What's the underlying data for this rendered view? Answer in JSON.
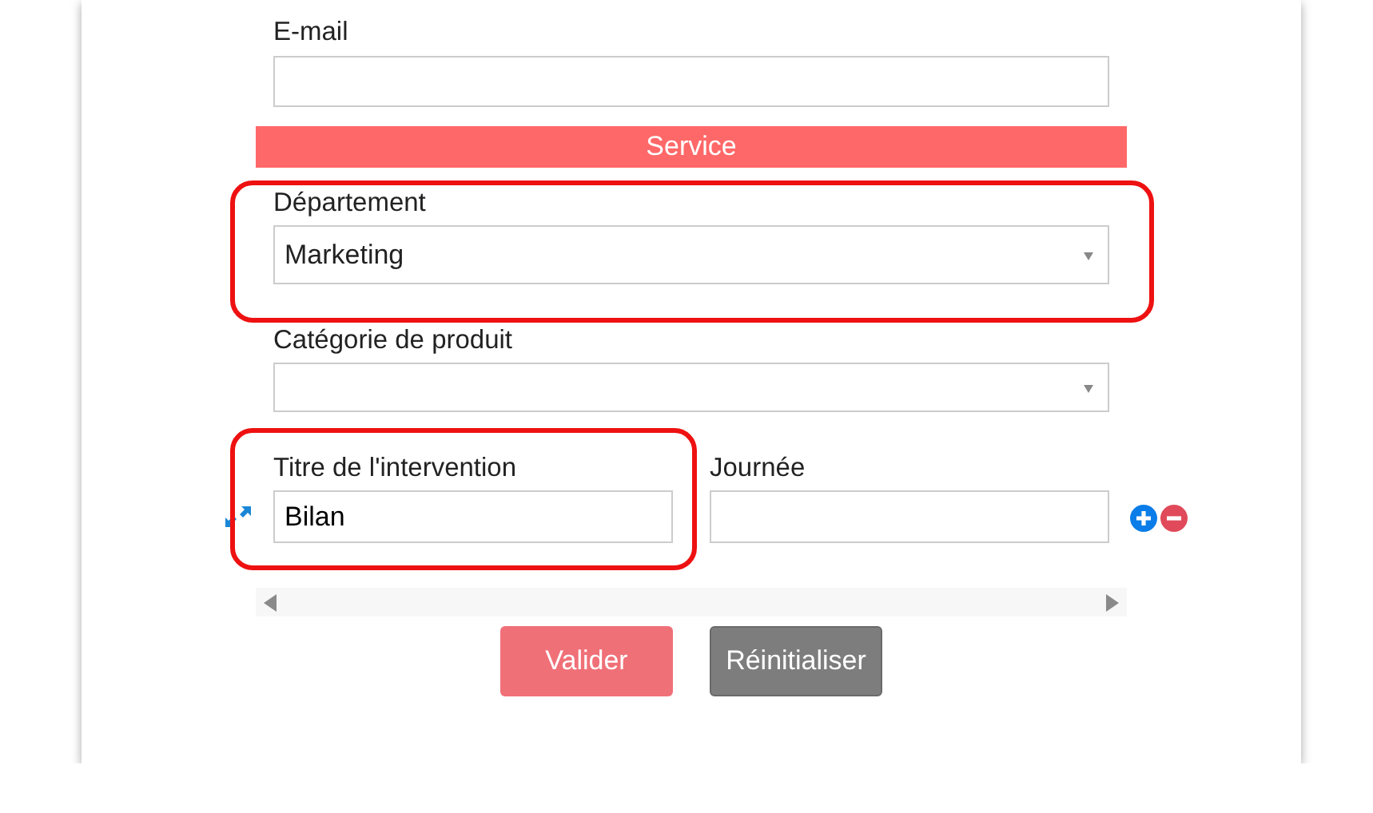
{
  "fields": [
    {
      "kind": "text",
      "label": "E-mail",
      "highlighted": false
    },
    {
      "kind": "section",
      "title": "Service"
    },
    {
      "kind": "select",
      "label": "Département",
      "value": "Marketing",
      "highlighted": true
    },
    {
      "kind": "select",
      "label": "Catégorie de produit",
      "highlighted": false
    }
  ],
  "row": [
    {
      "label": "Titre de l'intervention",
      "value": "Bilan",
      "highlighted": true
    },
    {
      "label": "Journée",
      "highlighted": false
    }
  ],
  "buttons": [
    {
      "label": "Valider",
      "kind": "primary"
    },
    {
      "label": "Réinitialiser",
      "kind": "secondary"
    }
  ]
}
